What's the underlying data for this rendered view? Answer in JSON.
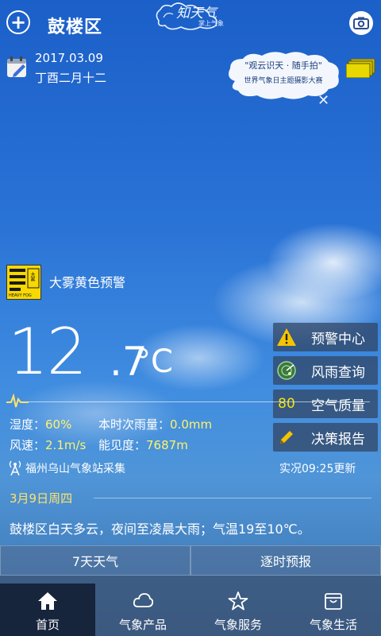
{
  "header": {
    "city": "鼓楼区",
    "brand_name": "知天气",
    "brand_sub": "掌上气象"
  },
  "date_info": {
    "date": "2017.03.09",
    "lunar": "丁酉二月十二"
  },
  "promo": {
    "line1": "\"观云识天 · 随手拍\"",
    "line2": "世界气象日主题摄影大赛"
  },
  "warning": {
    "badge_top": "大雾",
    "badge_code": "HEAVY FOG",
    "text": "大雾黄色预警"
  },
  "current": {
    "temp_int": "12",
    "temp_dec": ".7",
    "temp_unit": "°C",
    "humidity_label": "湿度：",
    "humidity": "60%",
    "rain_label": "本时次雨量：",
    "rain": "0.0mm",
    "wind_label": "风速：",
    "wind": "2.1m/s",
    "vis_label": "能见度：",
    "visibility": "7687m",
    "station": "福州乌山气象站采集",
    "update": "实况09:25更新"
  },
  "side_buttons": [
    {
      "label": "预警中心",
      "icon": "warning-triangle-icon"
    },
    {
      "label": "风雨查询",
      "icon": "radar-icon"
    },
    {
      "label": "空气质量",
      "value": "80"
    },
    {
      "label": "决策报告",
      "icon": "pencil-icon"
    }
  ],
  "forecast": {
    "date": "3月9日周四",
    "summary": "鼓楼区白天多云，夜间至凌晨大雨；气温19至10℃。"
  },
  "tabs": [
    "7天天气",
    "逐时预报"
  ],
  "nav": [
    {
      "label": "首页",
      "icon": "home-icon"
    },
    {
      "label": "气象产品",
      "icon": "cloud-icon"
    },
    {
      "label": "气象服务",
      "icon": "star-icon"
    },
    {
      "label": "气象生活",
      "icon": "bag-icon"
    }
  ],
  "colors": {
    "accent_yellow": "#fff36b",
    "warning_yellow": "#f7d800",
    "nav_active": "#16243c"
  }
}
